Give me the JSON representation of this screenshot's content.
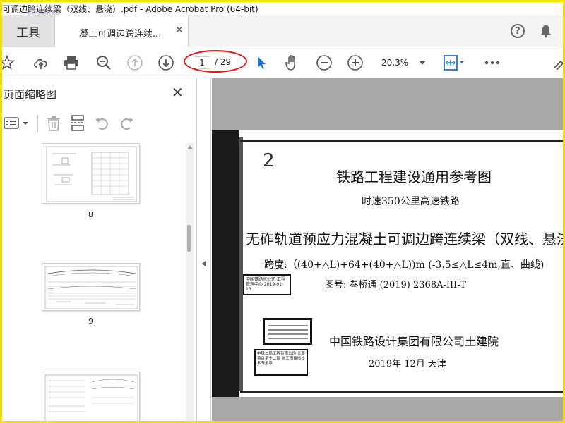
{
  "window": {
    "title": "可调边跨连续梁（双线、悬浇）.pdf - Adobe Acrobat Pro (64-bit)"
  },
  "tabs": {
    "tools_label": "工具",
    "doc_label": "凝土可调边跨连续..."
  },
  "toolbar": {
    "page_current": "1",
    "page_total": "/ 29",
    "zoom": "20.3%"
  },
  "sidebar": {
    "title": "页面缩略图",
    "thumbnails": [
      {
        "num": "8"
      },
      {
        "num": "9"
      },
      {
        "num": ""
      }
    ]
  },
  "document": {
    "handwriting": "2",
    "heading": "铁路工程建设通用参考图",
    "subheading": "时速350公里高速铁路",
    "main_title": "无砟轨道预应力混凝土可调边跨连续梁（双线、悬浇",
    "span": "跨度:（(40+△L)+64+(40+△L))m (-3.5≤△L≤4m,直、曲线)",
    "drawing_no": "图号: 叁桥通 (2019) 2368A-III-T",
    "institute": "中国铁路设计集团有限公司土建院",
    "date": "2019年  12月    天津",
    "stamp1": "中国铁路总公司 工程管理中心  2019-01-13",
    "stamp3": "中铁二局工程有限公司 贵南项目第十二部 施工图审核技术专用章"
  },
  "colors": {
    "accent_red": "#e01818",
    "frame_yellow": "#f0e000",
    "cursor_blue": "#1e6fd9"
  }
}
